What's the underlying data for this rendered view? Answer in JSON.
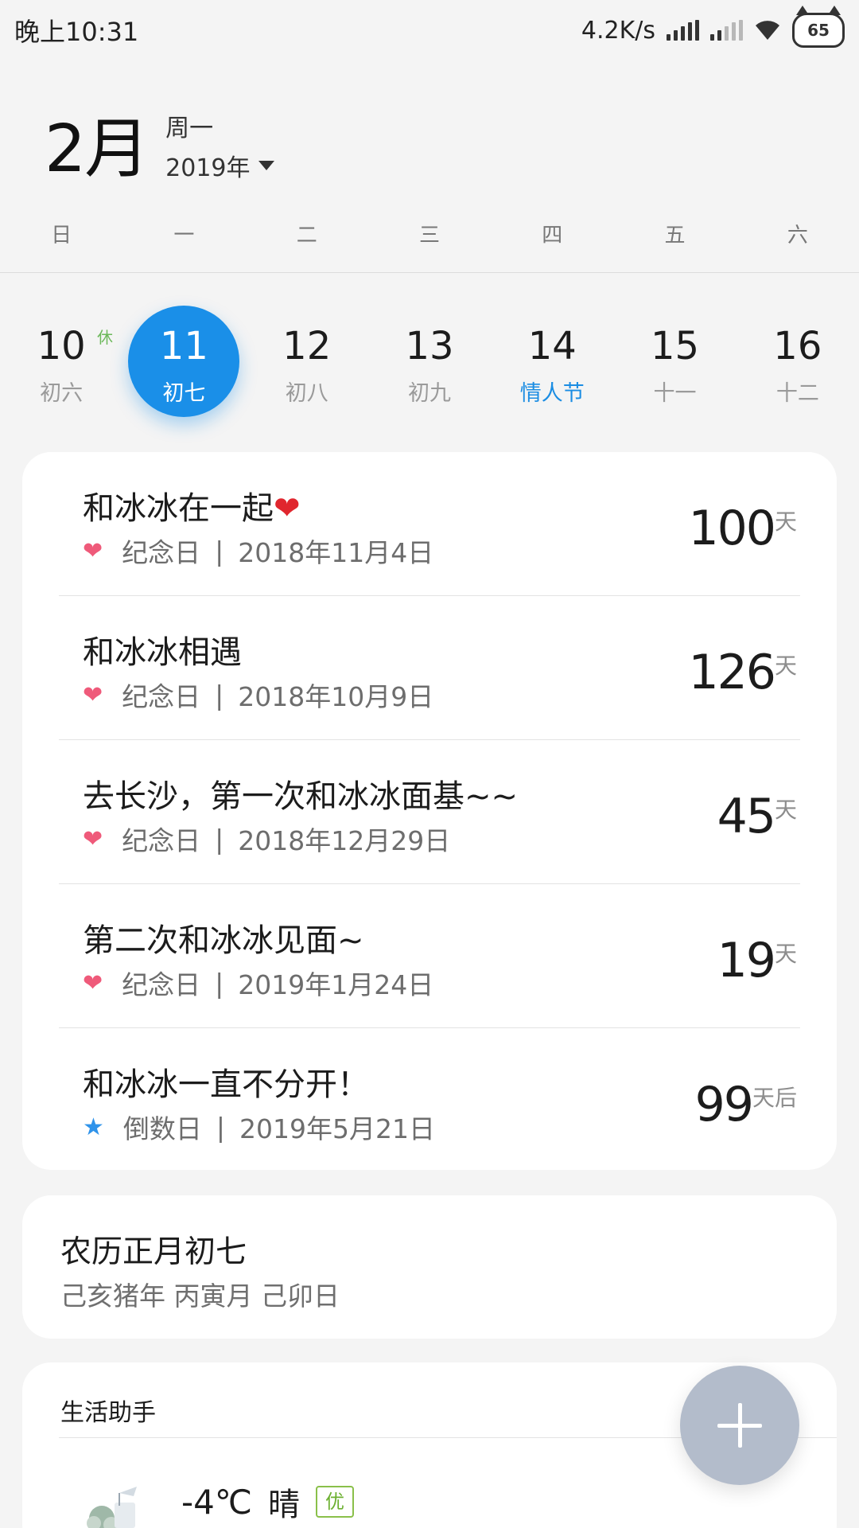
{
  "status_bar": {
    "time": "晚上10:31",
    "net_speed": "4.2K/s",
    "battery": "65"
  },
  "header": {
    "month": "2月",
    "weekday": "周一",
    "year": "2019年"
  },
  "weekdays": [
    "日",
    "一",
    "二",
    "三",
    "四",
    "五",
    "六"
  ],
  "dates": [
    {
      "num": "10",
      "lunar": "初六",
      "badge": "休"
    },
    {
      "num": "11",
      "lunar": "初七",
      "selected": true
    },
    {
      "num": "12",
      "lunar": "初八"
    },
    {
      "num": "13",
      "lunar": "初九"
    },
    {
      "num": "14",
      "lunar": "情人节",
      "festival": true
    },
    {
      "num": "15",
      "lunar": "十一"
    },
    {
      "num": "16",
      "lunar": "十二"
    }
  ],
  "events": [
    {
      "title": "和冰冰在一起",
      "title_emoji": "❤",
      "type": "纪念日",
      "date": "2018年11月4日",
      "count": "100",
      "unit": "天",
      "icon": "heart-icon"
    },
    {
      "title": "和冰冰相遇",
      "type": "纪念日",
      "date": "2018年10月9日",
      "count": "126",
      "unit": "天",
      "icon": "heart-icon"
    },
    {
      "title": "去长沙，第一次和冰冰面基~~",
      "type": "纪念日",
      "date": "2018年12月29日",
      "count": "45",
      "unit": "天",
      "icon": "heart-icon"
    },
    {
      "title": "第二次和冰冰见面~",
      "type": "纪念日",
      "date": "2019年1月24日",
      "count": "19",
      "unit": "天",
      "icon": "heart-icon"
    },
    {
      "title": "和冰冰一直不分开！",
      "type": "倒数日",
      "date": "2019年5月21日",
      "count": "99",
      "unit": "天后",
      "icon": "star-icon"
    }
  ],
  "meta_separator": "|",
  "lunar_card": {
    "title": "农历正月初七",
    "subtitle": "己亥猪年 丙寅月 己卯日"
  },
  "life_assistant": {
    "title": "生活助手",
    "temperature": "-4℃",
    "condition": "晴",
    "air_quality": "优"
  },
  "colors": {
    "accent_blue": "#1a8fe8",
    "heart_pink": "#ef5a7a",
    "star_blue": "#2f93ea",
    "rest_green": "#6cb85a",
    "fab_gray": "#b3bccb"
  }
}
